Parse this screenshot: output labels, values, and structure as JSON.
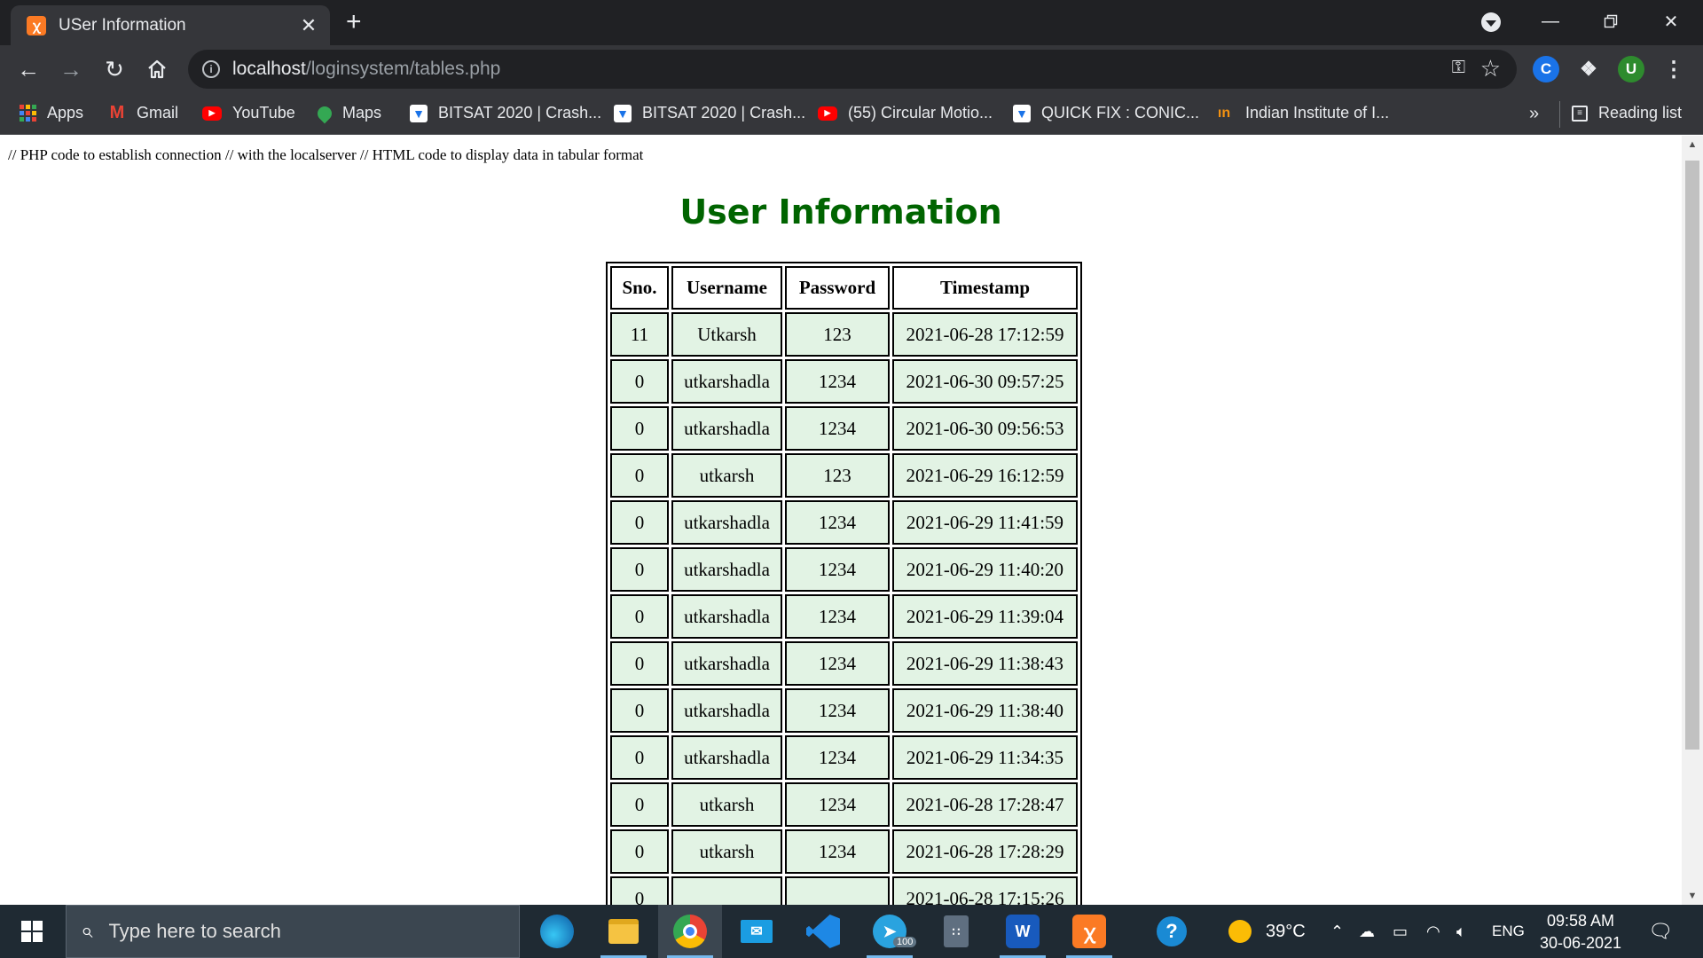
{
  "browser": {
    "tab_title": "USer Information",
    "tab_favicon": "xampp-icon",
    "address": {
      "host": "localhost",
      "path": "/loginsystem/tables.php"
    },
    "profile_initial": "U",
    "bookmarks": [
      {
        "label": "Apps",
        "icon": "apps-grid-icon"
      },
      {
        "label": "Gmail",
        "icon": "gmail-icon"
      },
      {
        "label": "YouTube",
        "icon": "youtube-icon"
      },
      {
        "label": "Maps",
        "icon": "maps-icon"
      },
      {
        "label": "BITSAT 2020 | Crash...",
        "icon": "bookmark-site-icon"
      },
      {
        "label": "BITSAT 2020 | Crash...",
        "icon": "bookmark-site-icon"
      },
      {
        "label": "(55) Circular Motio...",
        "icon": "youtube-icon"
      },
      {
        "label": "QUICK FIX : CONIC...",
        "icon": "bookmark-site-icon"
      },
      {
        "label": "Indian Institute of I...",
        "icon": "iiit-icon"
      }
    ],
    "more_bookmarks": "»",
    "reading_list": "Reading list"
  },
  "page": {
    "comment": "// PHP code to establish connection // with the localserver // HTML code to display data in tabular format",
    "heading": "User Information",
    "table": {
      "headers": [
        "Sno.",
        "Username",
        "Password",
        "Timestamp"
      ],
      "rows": [
        [
          "11",
          "Utkarsh",
          "123",
          "2021-06-28 17:12:59"
        ],
        [
          "0",
          "utkarshadla",
          "1234",
          "2021-06-30 09:57:25"
        ],
        [
          "0",
          "utkarshadla",
          "1234",
          "2021-06-30 09:56:53"
        ],
        [
          "0",
          "utkarsh",
          "123",
          "2021-06-29 16:12:59"
        ],
        [
          "0",
          "utkarshadla",
          "1234",
          "2021-06-29 11:41:59"
        ],
        [
          "0",
          "utkarshadla",
          "1234",
          "2021-06-29 11:40:20"
        ],
        [
          "0",
          "utkarshadla",
          "1234",
          "2021-06-29 11:39:04"
        ],
        [
          "0",
          "utkarshadla",
          "1234",
          "2021-06-29 11:38:43"
        ],
        [
          "0",
          "utkarshadla",
          "1234",
          "2021-06-29 11:38:40"
        ],
        [
          "0",
          "utkarshadla",
          "1234",
          "2021-06-29 11:34:35"
        ],
        [
          "0",
          "utkarsh",
          "1234",
          "2021-06-28 17:28:47"
        ],
        [
          "0",
          "utkarsh",
          "1234",
          "2021-06-28 17:28:29"
        ],
        [
          "0",
          "",
          "",
          "2021-06-28 17:15:26"
        ]
      ]
    }
  },
  "taskbar": {
    "search_placeholder": "Type here to search",
    "telegram_badge": "100",
    "weather": "39°C",
    "language": "ENG",
    "time": "09:58 AM",
    "date": "30-06-2021"
  },
  "colors": {
    "heading": "#006400",
    "cell_background": "#e2f3e4",
    "chrome_dark": "#202124",
    "chrome_toolbar": "#35363a",
    "taskbar": "#1f2a33"
  }
}
